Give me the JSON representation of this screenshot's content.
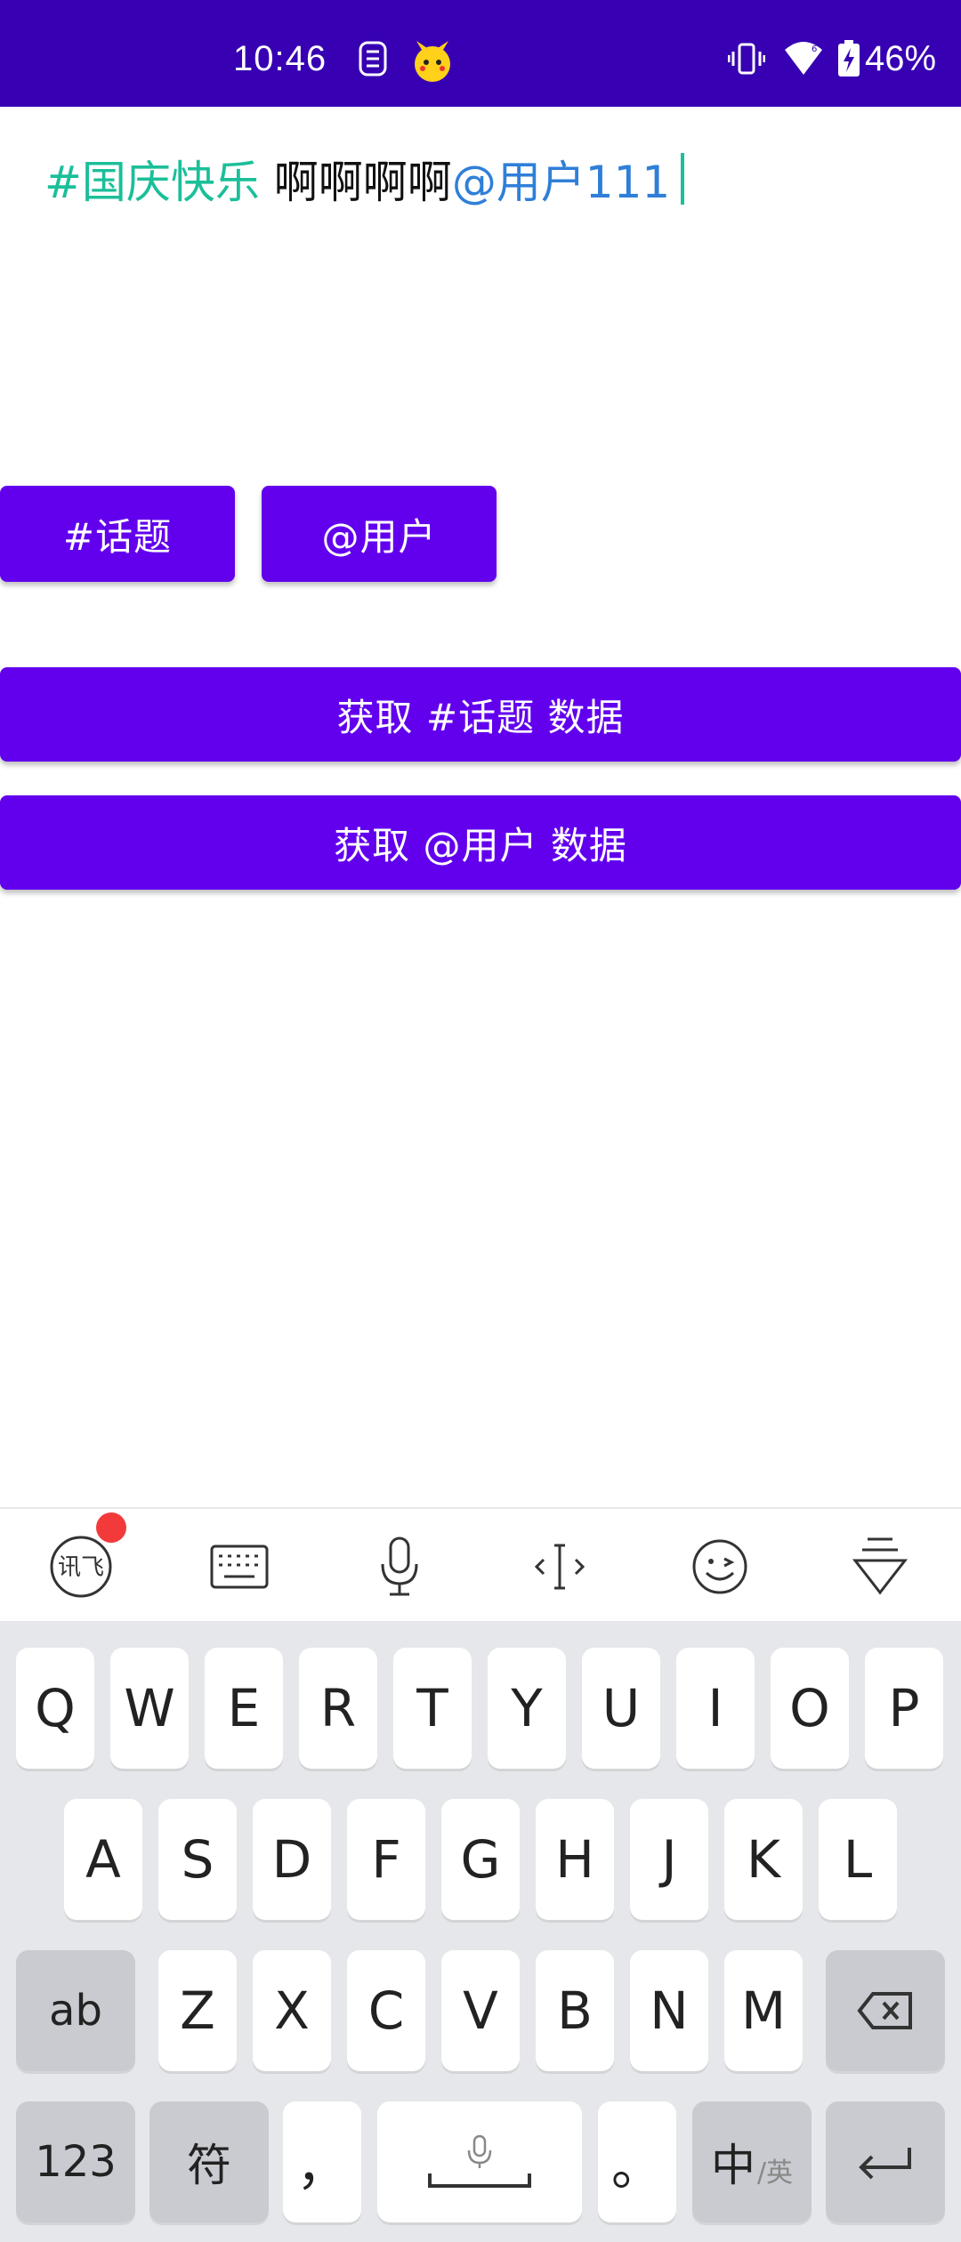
{
  "status_bar": {
    "time": "10:46",
    "battery": "46%",
    "icons": [
      "s-notification-icon",
      "pikachu-app-icon",
      "vibrate-icon",
      "wifi-icon",
      "battery-charging-icon"
    ]
  },
  "editor": {
    "topic": "#国庆快乐",
    "text": " 啊啊啊啊",
    "mention": "@用户111"
  },
  "buttons": {
    "topic": "#话题",
    "user": "@用户",
    "get_topic": "获取 #话题 数据",
    "get_user": "获取 @用户 数据"
  },
  "keyboard": {
    "toolbar": [
      "ifly-logo-icon",
      "keyboard-icon",
      "microphone-icon",
      "cursor-move-icon",
      "emoji-icon",
      "hide-keyboard-icon"
    ],
    "row1": [
      "Q",
      "W",
      "E",
      "R",
      "T",
      "Y",
      "U",
      "I",
      "O",
      "P"
    ],
    "row2": [
      "A",
      "S",
      "D",
      "F",
      "G",
      "H",
      "J",
      "K",
      "L"
    ],
    "row3": [
      "Z",
      "X",
      "C",
      "V",
      "B",
      "N",
      "M"
    ],
    "shift": "ab",
    "num": "123",
    "symbols": "符",
    "comma": "，",
    "period": "。",
    "lang_main": "中",
    "lang_sub": "/英"
  },
  "colors": {
    "status_bar": "#3700b3",
    "button": "#6200ee",
    "topic": "#1bbf99",
    "mention": "#2f7fd8"
  }
}
